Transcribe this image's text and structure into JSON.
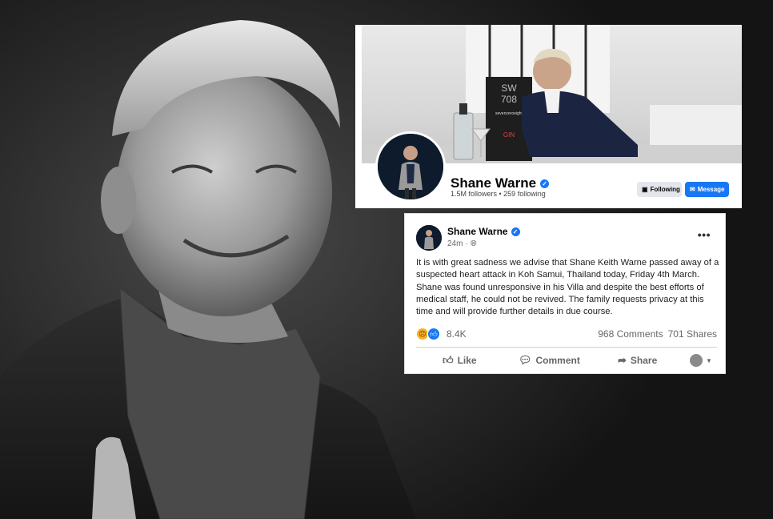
{
  "profile": {
    "name": "Shane Warne",
    "stats": "1.5M followers • 259 following",
    "following_label": "Following",
    "message_label": "Message",
    "cover": {
      "box_code_top": "SW",
      "box_code_bottom": "708",
      "brand": "sevenzeroeight",
      "product": "GIN"
    }
  },
  "post": {
    "author": "Shane Warne",
    "time": "24m",
    "body": "It is with great sadness we advise that Shane Keith Warne passed away of a suspected heart attack in Koh Samui, Thailand today, Friday 4th March.  Shane was found unresponsive in his Villa and despite the best efforts of medical staff, he could not be revived.  The family requests privacy at this time and will provide further details in due course.",
    "reaction_count": "8.4K",
    "comments": "968 Comments",
    "shares": "701 Shares",
    "actions": {
      "like": "Like",
      "comment": "Comment",
      "share": "Share"
    },
    "more": "•••"
  },
  "icons": {
    "verified": "verified-badge-icon",
    "globe": "globe-icon",
    "like": "thumbs-up-icon",
    "comment": "comment-bubble-icon",
    "share": "share-arrow-icon",
    "messenger": "messenger-icon",
    "following": "following-check-icon"
  },
  "colors": {
    "facebook_blue": "#1877f2",
    "sad_reaction": "#f7b125",
    "muted_text": "#65676b"
  }
}
